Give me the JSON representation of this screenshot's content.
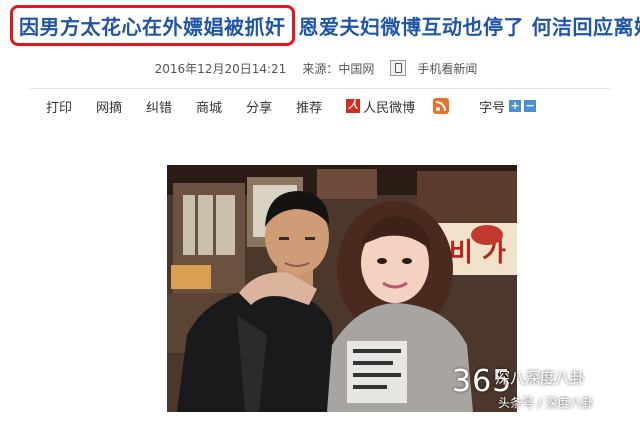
{
  "headline": {
    "highlighted": "因男方太花心在外嫖娼被抓奸",
    "rest": "恩爱夫妇微博互动也停了 何洁回应离婚"
  },
  "meta": {
    "datetime": "2016年12月20日14:21",
    "source": "来源：中国网",
    "mobile_news": "手机看新闻"
  },
  "toolbar": {
    "print": "打印",
    "excerpt": "网摘",
    "correct": "纠错",
    "mall": "商城",
    "share": "分享",
    "recommend": "推荐",
    "weibo_icon": "人",
    "weibo_label": "人民微博",
    "fontsize_label": "字号",
    "fontsize_plus": "+",
    "fontsize_minus": "−"
  },
  "watermark": {
    "number": "365",
    "brand": "深八深度八卦",
    "sub": "头条号 / 深度八卦"
  },
  "colors": {
    "headline": "#1f55a8",
    "highlight_border": "#e3171b",
    "weibo": "#d52b1e",
    "rss": "#e8712b",
    "fontsize_button": "#4a8fd6"
  },
  "photo_sign_text": "비 가"
}
